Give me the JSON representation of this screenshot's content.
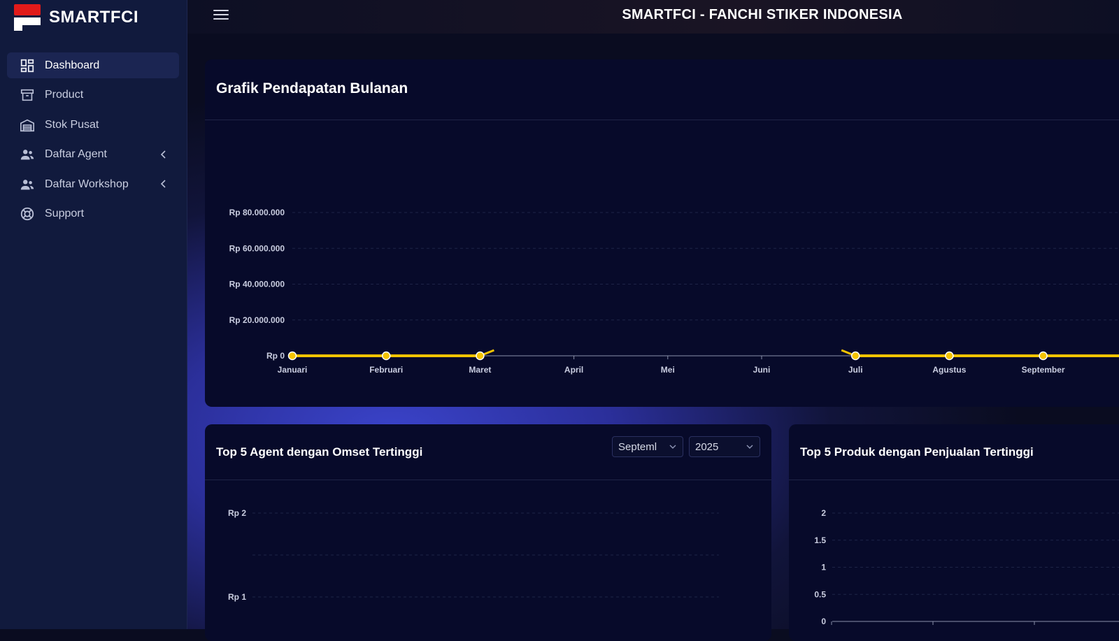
{
  "brand": {
    "name": "SMARTFCI",
    "logo_colors": {
      "top": "#e11a1a",
      "bottom": "#ffffff"
    }
  },
  "header": {
    "title": "SMARTFCI - FANCHI STIKER INDONESIA",
    "menu_icon": "hamburger-icon"
  },
  "sidebar": {
    "items": [
      {
        "label": "Dashboard",
        "icon": "dashboard-icon",
        "active": true
      },
      {
        "label": "Product",
        "icon": "archive-icon"
      },
      {
        "label": "Stok Pusat",
        "icon": "warehouse-icon"
      },
      {
        "label": "Daftar Agent",
        "icon": "users-icon",
        "has_submenu": true
      },
      {
        "label": "Daftar Workshop",
        "icon": "users-icon",
        "has_submenu": true
      },
      {
        "label": "Support",
        "icon": "lifebuoy-icon"
      }
    ]
  },
  "revenue_card": {
    "title": "Grafik Pendapatan Bulanan"
  },
  "agent_card": {
    "title": "Top 5 Agent dengan Omset Tertinggi",
    "month_select": "Septeml",
    "year_select": "2025"
  },
  "product_card": {
    "title": "Top 5 Produk dengan Penjualan Tertinggi"
  },
  "chart_data": [
    {
      "type": "line",
      "title": "Grafik Pendapatan Bulanan",
      "categories": [
        "Januari",
        "Februari",
        "Maret",
        "April",
        "Mei",
        "Juni",
        "Juli",
        "Agustus",
        "September"
      ],
      "y_ticks": [
        "Rp 0",
        "Rp 20.000.000",
        "Rp 40.000.000",
        "Rp 60.000.000",
        "Rp 80.000.000"
      ],
      "ylim": [
        0,
        80000000
      ],
      "series": [
        {
          "values": [
            0,
            0,
            0,
            null,
            null,
            null,
            0,
            0,
            0
          ],
          "color": "#f5c400"
        }
      ],
      "grid": true
    },
    {
      "type": "bar",
      "title": "Top 5 Agent dengan Omset Tertinggi",
      "y_ticks": [
        "Rp 1",
        "Rp 2"
      ],
      "ylim": [
        0,
        2
      ],
      "grid": true
    },
    {
      "type": "bar",
      "title": "Top 5 Produk dengan Penjualan Tertinggi",
      "y_ticks": [
        "0",
        "0.5",
        "1",
        "1.5",
        "2"
      ],
      "ylim": [
        0,
        2
      ],
      "grid": true
    }
  ]
}
